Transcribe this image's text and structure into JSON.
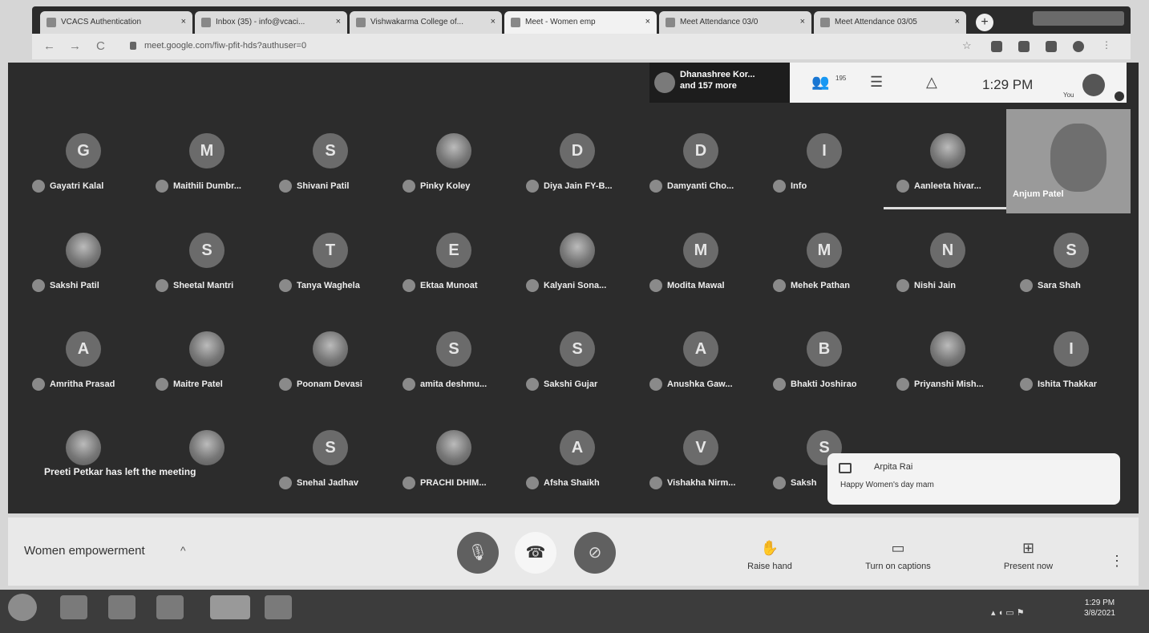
{
  "browser": {
    "tabs": [
      {
        "title": "VCACS Authentication",
        "icon": "globe-icon"
      },
      {
        "title": "Inbox (35) - info@vcaci...",
        "icon": "gmail-icon"
      },
      {
        "title": "Vishwakarma College of...",
        "icon": "document-icon"
      },
      {
        "title": "Meet - Women emp",
        "icon": "meet-icon",
        "active": true
      },
      {
        "title": "Meet Attendance 03/0",
        "icon": "refresh-icon"
      },
      {
        "title": "Meet Attendance 03/05",
        "icon": "refresh-icon"
      }
    ],
    "new_tab": "+",
    "url": "meet.google.com/fiw-pfit-hds?authuser=0"
  },
  "meet": {
    "participants_summary": "Dhanashree Kor...",
    "participants_more": "and 157 more",
    "people_count": "195",
    "clock": "1:29 PM",
    "you_label": "You",
    "rows": [
      [
        {
          "initial": "G",
          "name": "Gayatri Kalal"
        },
        {
          "initial": "M",
          "name": "Maithili Dumbr..."
        },
        {
          "initial": "S",
          "name": "Shivani Patil"
        },
        {
          "initial": "",
          "name": "Pinky Koley",
          "photo": true
        },
        {
          "initial": "D",
          "name": "Diya Jain FY-B..."
        },
        {
          "initial": "D",
          "name": "Damyanti Cho..."
        },
        {
          "initial": "I",
          "name": "Info"
        },
        {
          "initial": "",
          "name": "Aanleeta hivar...",
          "photo": true
        }
      ],
      [
        {
          "initial": "",
          "name": "Sakshi Patil",
          "photo": true
        },
        {
          "initial": "S",
          "name": "Sheetal Mantri"
        },
        {
          "initial": "T",
          "name": "Tanya Waghela"
        },
        {
          "initial": "E",
          "name": "Ektaa Munoat"
        },
        {
          "initial": "",
          "name": "Kalyani Sona...",
          "photo": true
        },
        {
          "initial": "M",
          "name": "Modita Mawal"
        },
        {
          "initial": "M",
          "name": "Mehek Pathan"
        },
        {
          "initial": "N",
          "name": "Nishi Jain"
        },
        {
          "initial": "S",
          "name": "Sara Shah"
        }
      ],
      [
        {
          "initial": "A",
          "name": "Amritha Prasad"
        },
        {
          "initial": "",
          "name": "Maitre Patel",
          "photo": true
        },
        {
          "initial": "",
          "name": "Poonam Devasi",
          "photo": true
        },
        {
          "initial": "S",
          "name": "amita deshmu..."
        },
        {
          "initial": "S",
          "name": "Sakshi Gujar"
        },
        {
          "initial": "A",
          "name": "Anushka Gaw..."
        },
        {
          "initial": "B",
          "name": "Bhakti Joshirao"
        },
        {
          "initial": "",
          "name": "Priyanshi Mish...",
          "photo": true
        },
        {
          "initial": "I",
          "name": "Ishita Thakkar"
        }
      ],
      [
        {
          "initial": "",
          "name": "",
          "photo": true
        },
        {
          "initial": "",
          "name": "",
          "photo": true
        },
        {
          "initial": "S",
          "name": "Snehal Jadhav"
        },
        {
          "initial": "",
          "name": "PRACHI DHIM...",
          "photo": true
        },
        {
          "initial": "A",
          "name": "Afsha Shaikh"
        },
        {
          "initial": "V",
          "name": "Vishakha Nirm..."
        },
        {
          "initial": "S",
          "name": "Saksh"
        }
      ]
    ],
    "speaker_name": "Anjum Patel",
    "left_notice": "Preeti Petkar has left the meeting",
    "chat": {
      "sender": "Arpita Rai",
      "message": "Happy Women's day mam"
    }
  },
  "controls": {
    "meeting_title": "Women empowerment",
    "raise_hand": "Raise hand",
    "captions": "Turn on captions",
    "present": "Present now"
  },
  "taskbar": {
    "time": "1:29 PM",
    "date": "3/8/2021"
  },
  "icons": {
    "mic": "mic-off-icon",
    "hangup": "call-end-icon",
    "camera": "camera-off-icon",
    "raise_hand": "hand-icon",
    "captions": "captions-icon",
    "present": "present-icon",
    "more": "more-vert-icon"
  }
}
